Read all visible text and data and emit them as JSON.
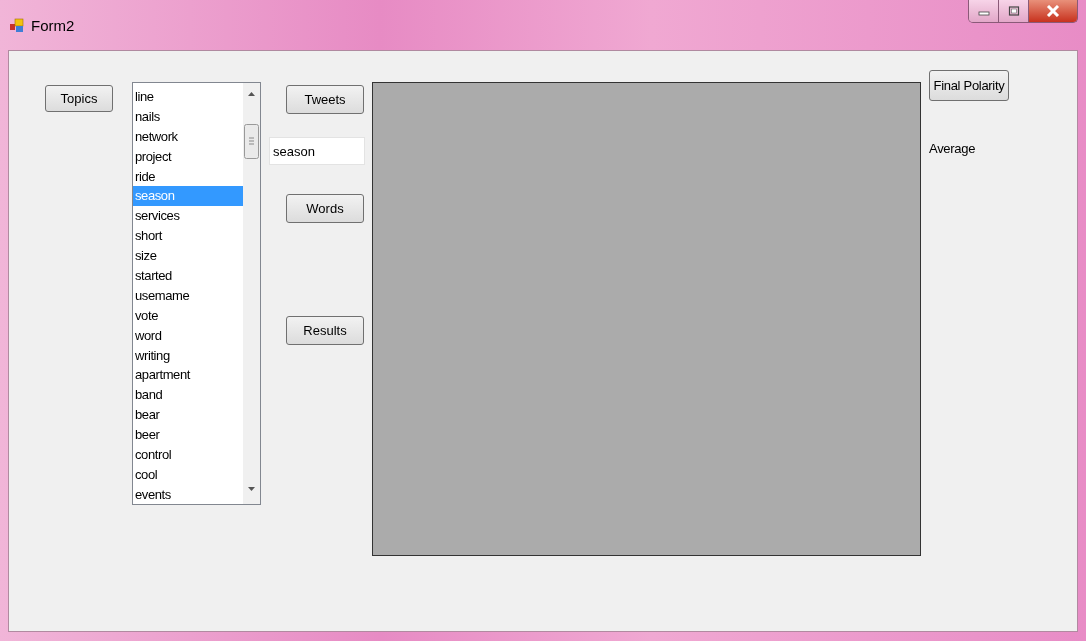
{
  "window": {
    "title": "Form2"
  },
  "topics_button": "Topics",
  "topics_list": [
    {
      "label": "line",
      "selected": false
    },
    {
      "label": "nails",
      "selected": false
    },
    {
      "label": "network",
      "selected": false
    },
    {
      "label": "project",
      "selected": false
    },
    {
      "label": "ride",
      "selected": false
    },
    {
      "label": "season",
      "selected": true
    },
    {
      "label": "services",
      "selected": false
    },
    {
      "label": "short",
      "selected": false
    },
    {
      "label": "size",
      "selected": false
    },
    {
      "label": "started",
      "selected": false
    },
    {
      "label": "usemame",
      "selected": false
    },
    {
      "label": "vote",
      "selected": false
    },
    {
      "label": "word",
      "selected": false
    },
    {
      "label": "writing",
      "selected": false
    },
    {
      "label": "apartment",
      "selected": false
    },
    {
      "label": "band",
      "selected": false
    },
    {
      "label": "bear",
      "selected": false
    },
    {
      "label": "beer",
      "selected": false
    },
    {
      "label": "control",
      "selected": false
    },
    {
      "label": "cool",
      "selected": false
    },
    {
      "label": "events",
      "selected": false
    }
  ],
  "tweets_button": "Tweets",
  "topic_field": {
    "value": "season"
  },
  "words_button": "Words",
  "results_button": "Results",
  "final_polarity_button": "Final Polarity",
  "polarity_label": "Average"
}
